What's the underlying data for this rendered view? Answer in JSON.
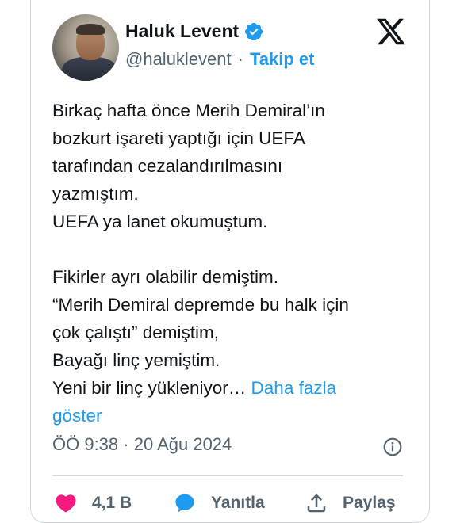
{
  "author": {
    "name": "Haluk Levent",
    "handle": "@haluklevent",
    "separator": "·",
    "follow_label": "Takip et"
  },
  "tweet": {
    "lines": [
      "Birkaç hafta önce Merih Demiral’ın",
      "bozkurt işareti yaptığı için UEFA",
      "tarafından cezalandırılmasını",
      "yazmıştım.",
      "UEFA ya lanet okumuştum.",
      "",
      "Fikirler ayrı olabilir demiştim.",
      "“Merih Demiral depremde bu halk için",
      "çok çalıştı” demiştim,",
      "Bayağı linç yemiştim.",
      "Yeni bir linç yükleniyor…"
    ],
    "more_label_1": "Daha fazla",
    "more_label_2": "göster"
  },
  "meta": {
    "timestamp": "ÖÖ 9:38 · 20 Ağu 2024"
  },
  "actions": {
    "likes": "4,1 B",
    "reply_label": "Yanıtla",
    "share_label": "Paylaş"
  },
  "icons": {
    "logo": "x-logo-icon",
    "verified": "verified-badge-icon",
    "info": "info-icon",
    "like": "heart-icon",
    "reply": "speech-bubble-icon",
    "share": "share-arrow-icon"
  },
  "colors": {
    "accent": "#1d9bf0",
    "like": "#f91880",
    "text": "#0f1419",
    "secondary": "#536471",
    "border": "#cfd9de"
  }
}
